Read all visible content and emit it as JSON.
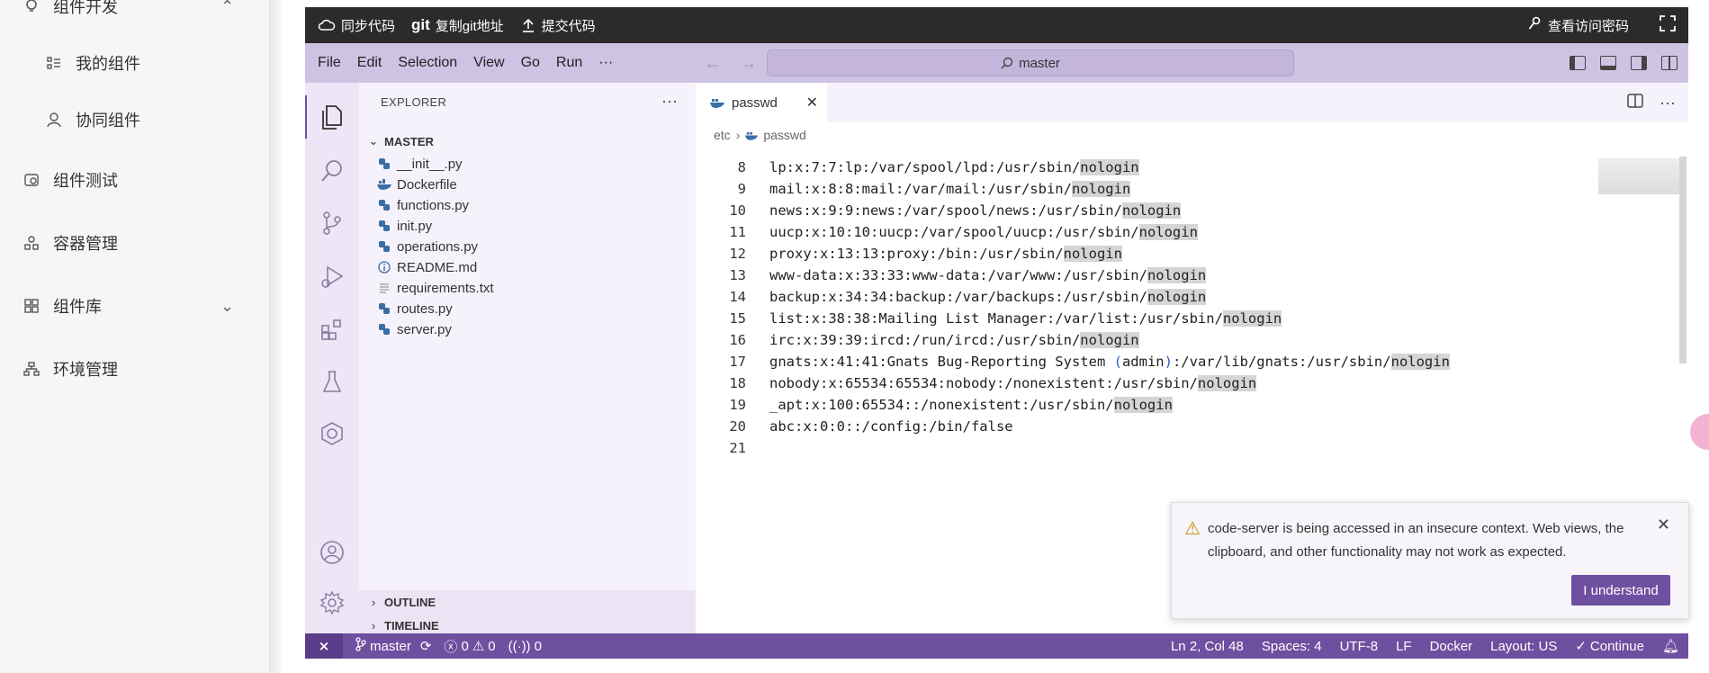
{
  "app_sidebar": {
    "items": [
      {
        "label": "组件开发",
        "icon": "bulb-icon"
      },
      {
        "label": "我的组件",
        "icon": "list-icon"
      },
      {
        "label": "协同组件",
        "icon": "user-icon"
      },
      {
        "label": "组件测试",
        "icon": "test-icon"
      },
      {
        "label": "容器管理",
        "icon": "container-icon"
      },
      {
        "label": "组件库",
        "icon": "grid-icon"
      },
      {
        "label": "环境管理",
        "icon": "tree-icon"
      }
    ]
  },
  "topbar": {
    "sync_label": "同步代码",
    "git_label": "git",
    "copy_git_label": "复制git地址",
    "submit_label": "提交代码",
    "view_password_label": "查看访问密码"
  },
  "menubar": {
    "items": [
      "File",
      "Edit",
      "Selection",
      "View",
      "Go",
      "Run",
      "···"
    ],
    "command_center": "master"
  },
  "explorer": {
    "title": "EXPLORER",
    "root": "MASTER",
    "files": [
      {
        "name": "__init__.py",
        "icon": "python-icon"
      },
      {
        "name": "Dockerfile",
        "icon": "docker-icon"
      },
      {
        "name": "functions.py",
        "icon": "python-icon"
      },
      {
        "name": "init.py",
        "icon": "python-icon"
      },
      {
        "name": "operations.py",
        "icon": "python-icon"
      },
      {
        "name": "README.md",
        "icon": "info-icon"
      },
      {
        "name": "requirements.txt",
        "icon": "text-file-icon"
      },
      {
        "name": "routes.py",
        "icon": "python-icon"
      },
      {
        "name": "server.py",
        "icon": "python-icon"
      }
    ],
    "outline": "OUTLINE",
    "timeline": "TIMELINE"
  },
  "editor": {
    "tab": "passwd",
    "breadcrumb": [
      "etc",
      "passwd"
    ],
    "lines": [
      {
        "n": "8",
        "pre": "lp:x:7:7:lp:/var/spool/lpd:/usr/sbin/",
        "hl": "nologin"
      },
      {
        "n": "9",
        "pre": "mail:x:8:8:mail:/var/mail:/usr/sbin/",
        "hl": "nologin"
      },
      {
        "n": "10",
        "pre": "news:x:9:9:news:/var/spool/news:/usr/sbin/",
        "hl": "nologin"
      },
      {
        "n": "11",
        "pre": "uucp:x:10:10:uucp:/var/spool/uucp:/usr/sbin/",
        "hl": "nologin"
      },
      {
        "n": "12",
        "pre": "proxy:x:13:13:proxy:/bin:/usr/sbin/",
        "hl": "nologin"
      },
      {
        "n": "13",
        "pre": "www-data:x:33:33:www-data:/var/www:/usr/sbin/",
        "hl": "nologin"
      },
      {
        "n": "14",
        "pre": "backup:x:34:34:backup:/var/backups:/usr/sbin/",
        "hl": "nologin"
      },
      {
        "n": "15",
        "pre": "list:x:38:38:Mailing List Manager:/var/list:/usr/sbin/",
        "hl": "nologin"
      },
      {
        "n": "16",
        "pre": "irc:x:39:39:ircd:/run/ircd:/usr/sbin/",
        "hl": "nologin"
      },
      {
        "n": "17",
        "pre": "gnats:x:41:41:Gnats Bug-Reporting System (admin):/var/lib/gnats:/usr/sbin/",
        "hl": "nologin"
      },
      {
        "n": "18",
        "pre": "nobody:x:65534:65534:nobody:/nonexistent:/usr/sbin/",
        "hl": "nologin"
      },
      {
        "n": "19",
        "pre": "_apt:x:100:65534::/nonexistent:/usr/sbin/",
        "hl": "nologin"
      },
      {
        "n": "20",
        "pre": "abc:x:0:0::/config:/bin/false",
        "hl": ""
      },
      {
        "n": "21",
        "pre": "",
        "hl": ""
      }
    ]
  },
  "notification": {
    "message": "code-server is being accessed in an insecure context. Web views, the clipboard, and other functionality may not work as expected.",
    "button": "I understand"
  },
  "statusbar": {
    "branch": "master",
    "errors": "0",
    "warnings": "0",
    "ports": "0",
    "position": "Ln 2, Col 48",
    "spaces": "Spaces: 4",
    "encoding": "UTF-8",
    "eol": "LF",
    "language": "Docker",
    "layout": "Layout: US",
    "continue": "Continue"
  }
}
